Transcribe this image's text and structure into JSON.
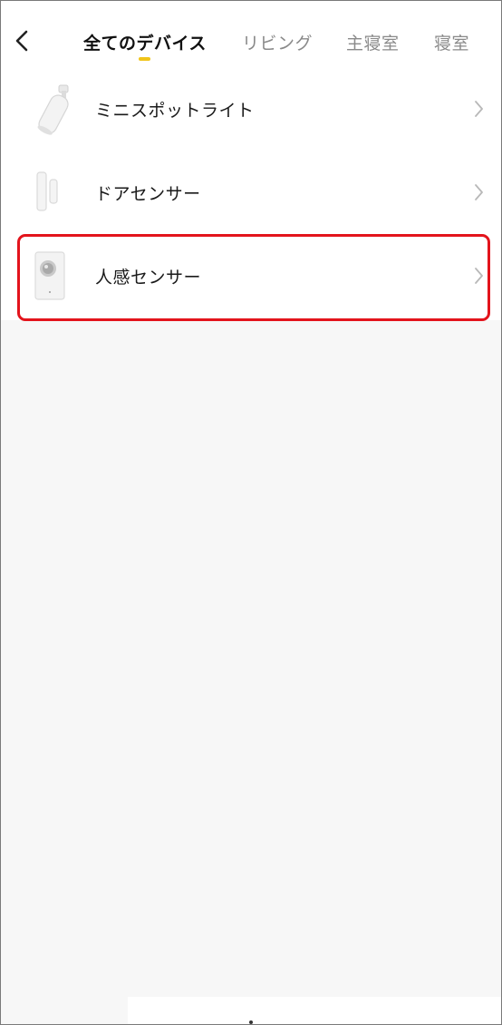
{
  "header": {
    "back_icon": "chevron-left-icon",
    "tabs": [
      {
        "label": "全てのデバイス",
        "active": true
      },
      {
        "label": "リビング",
        "active": false
      },
      {
        "label": "主寝室",
        "active": false
      },
      {
        "label": "寝室",
        "active": false
      }
    ],
    "accent_color": "#f0c419"
  },
  "devices": [
    {
      "name": "ミニスポットライト",
      "icon": "spotlight-icon"
    },
    {
      "name": "ドアセンサー",
      "icon": "door-sensor-icon"
    },
    {
      "name": "人感センサー",
      "icon": "motion-sensor-icon",
      "highlighted": true
    }
  ],
  "highlight_color": "#e3141c"
}
